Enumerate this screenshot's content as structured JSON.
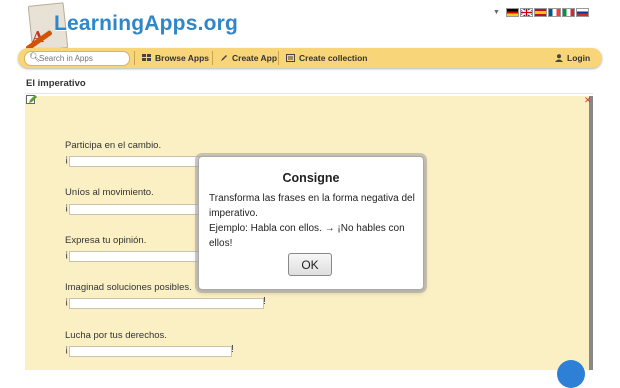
{
  "site": {
    "name": "LearningApps.org"
  },
  "languages": [
    "de",
    "en",
    "es",
    "fr",
    "it",
    "ru"
  ],
  "nav": {
    "search_placeholder": "Search in Apps",
    "browse": "Browse Apps",
    "create": "Create App",
    "collection": "Create collection",
    "login": "Login"
  },
  "page": {
    "title": "El imperativo"
  },
  "exercise": {
    "items": [
      {
        "prompt": "Participa en el cambio.",
        "prefix": "¡",
        "suffix": "",
        "value": ""
      },
      {
        "prompt": "Uníos al movimiento.",
        "prefix": "¡",
        "suffix": "",
        "value": ""
      },
      {
        "prompt": "Expresa tu opinión.",
        "prefix": "¡",
        "suffix": "",
        "value": ""
      },
      {
        "prompt": "Imaginad soluciones posibles.",
        "prefix": "¡",
        "suffix": "!",
        "value": ""
      },
      {
        "prompt": "Lucha por tus derechos.",
        "prefix": "¡",
        "suffix": "!",
        "value": ""
      }
    ]
  },
  "dialog": {
    "title": "Consigne",
    "text": "Transforma las frases en la forma negativa del imperativo.\nEjemplo: Habla con ellos. → ¡No hables con ellos!",
    "ok": "OK"
  },
  "colors": {
    "navbar": "#f9d57a",
    "app_bg": "#fbf0c4",
    "logo_text": "#2f86c9",
    "help_button": "#2e7fd6"
  }
}
